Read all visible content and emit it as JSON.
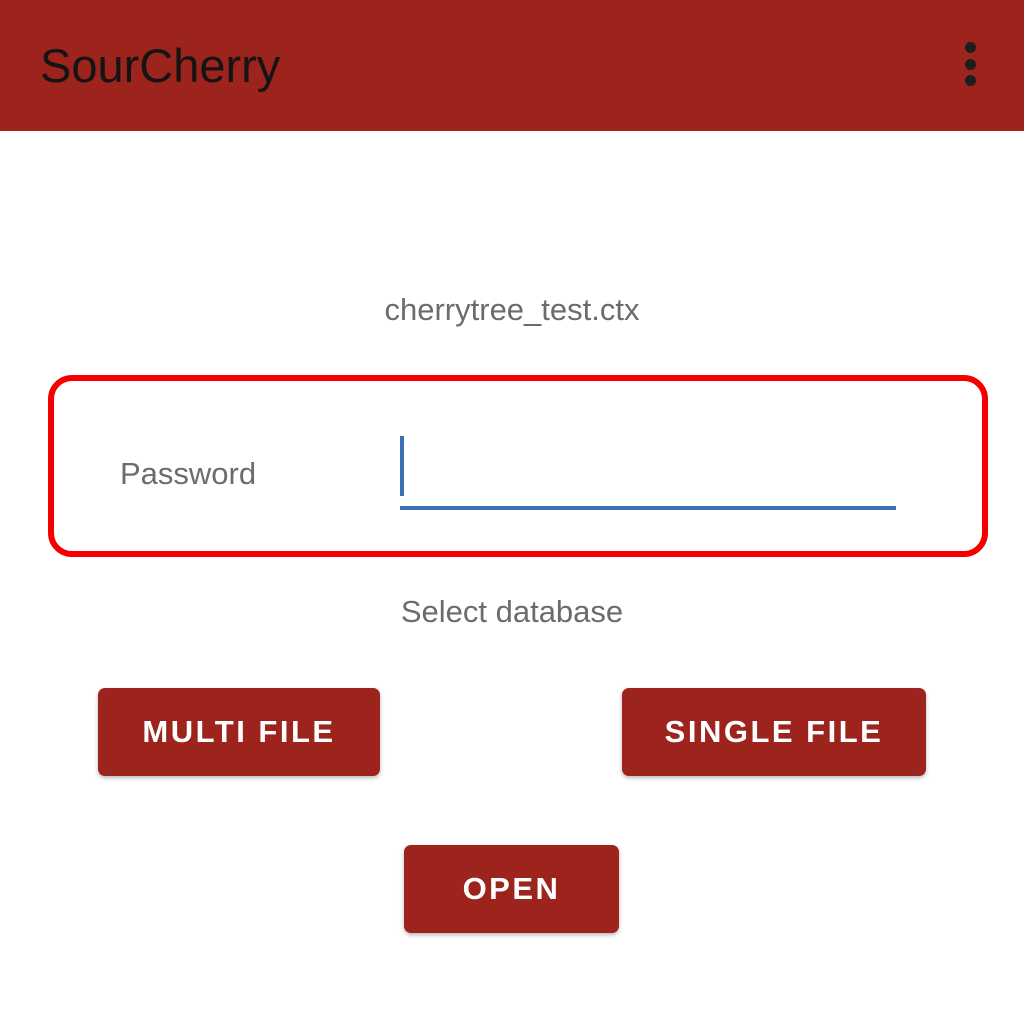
{
  "app_bar": {
    "title": "SourCherry",
    "menu_icon": "overflow-menu-icon",
    "color": "#9d241d"
  },
  "main": {
    "file_name": "cherrytree_test.ctx",
    "password_label": "Password",
    "password_value": "",
    "select_database_label": "Select database",
    "multi_file_button": "MULTI FILE",
    "single_file_button": "SINGLE FILE",
    "open_button": "OPEN"
  },
  "colors": {
    "accent": "#9d241d",
    "input_underline": "#3a6fb3",
    "highlight": "#f50000"
  }
}
